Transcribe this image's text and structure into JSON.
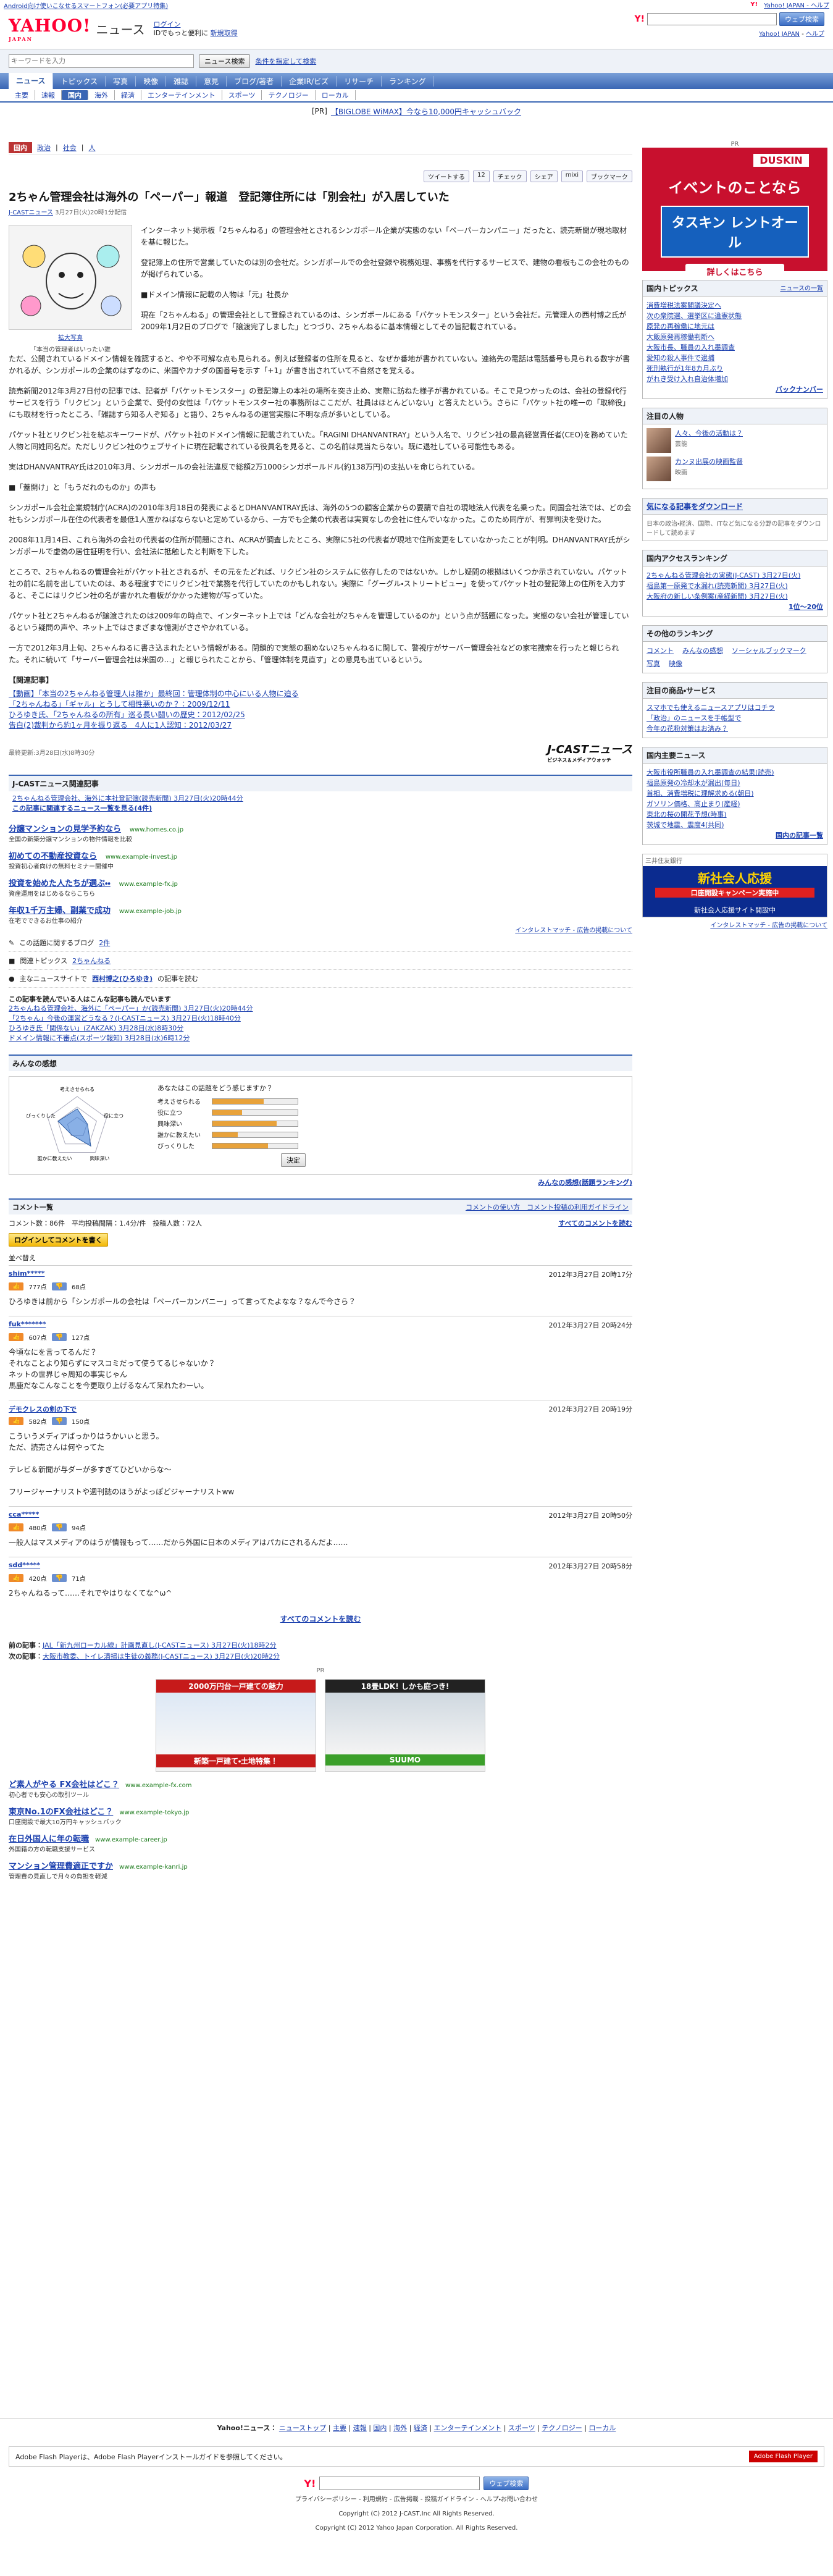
{
  "topstrip": {
    "promo": "Android向け使いこなせるスマートフォン(必要アプリ特集)",
    "home_link": "Yahoo! JAPAN - ヘルプ"
  },
  "header": {
    "logo": "YAHOO!",
    "logo_sub": "JAPAN",
    "service": "ニュース",
    "login": "ログイン",
    "signup_prompt": "IDでもっと便利に",
    "signup": "新規取得",
    "yahoo_top_link": "Yahoo! JAPAN",
    "help_link": "ヘルプ",
    "search_button": "ウェブ検索"
  },
  "news_search": {
    "placeholder": "キーワードを入力",
    "button": "ニュース検索",
    "advanced": "条件を指定して検索"
  },
  "nav_main": [
    "ニュース",
    "トピックス",
    "写真",
    "映像",
    "雑誌",
    "意見",
    "ブログ/著者",
    "企業IR/ビズ",
    "リサーチ",
    "ランキング"
  ],
  "nav_sub": [
    "主要",
    "速報",
    "国内",
    "海外",
    "経済",
    "エンターテインメント",
    "スポーツ",
    "テクノロジー",
    "ローカル"
  ],
  "pr": {
    "tag": "[PR]",
    "text": "【BIGLOBE WiMAX】今なら10,000円キャッシュバック"
  },
  "crumbs": {
    "tag": "国内",
    "items": [
      "政治",
      "社会",
      "人"
    ]
  },
  "share": {
    "tweet": "ツイートする",
    "count": "12",
    "check": "チェック",
    "fb": "シェア",
    "mixi": "mixi",
    "bookmark": "ブックマーク"
  },
  "article": {
    "title": "2ちゃん管理会社は海外の「ペーパー」報道　登記簿住所には「別会社」が入居していた",
    "source_link": "J-CASTニュース",
    "date": "3月27日(火)20時1分配信",
    "photo_caption": "「本当の管理者はいったい誰",
    "enlarge": "拡大写真",
    "paragraphs": [
      "インターネット掲示板「2ちゃんねる」の管理会社とされるシンガポール企業が実態のない「ペーパーカンパニー」だったと、読売新聞が現地取材を基に報じた。",
      "登記簿上の住所で営業していたのは別の会社だ。シンガポールでの会社登録や税務処理、事務を代行するサービスで、建物の看板もこの会社のものが掲げられている。",
      "■ドメイン情報に記載の人物は「元」社長か",
      "現在「2ちゃんねる」の管理会社として登録されているのは、シンガポールにある「パケットモンスター」という会社だ。元管理人の西村博之氏が2009年1月2日のブログで「譲渡完了しました」とつづり、2ちゃんねるに基本情報としてその旨記載されている。",
      "ただ、公開されているドメイン情報を確認すると、やや不可解な点も見られる。例えば登録者の住所を見ると、なぜか番地が書かれていない。連絡先の電話は電話番号も見られる数字が書かれるが、シンガポールの企業のはずなのに、米国やカナダの国番号を示す「+1」が書き出されていて不自然さを覚える。",
      "読売新聞2012年3月27日付の記事では、記者が「パケットモンスター」の登記簿上の本社の場所を突き止め、実際に訪ねた様子が書かれている。そこで見つかったのは、会社の登録代行サービスを行う「リクビン」という企業で、受付の女性は「パケットモンスター社の事務所はここだが、社員はほとんどいない」と答えたという。さらに「パケット社の唯一の「取締役」にも取材を行ったところ、「雑誌すら知る人ぞ知る」と語り、2ちゃんねるの運営実態に不明な点が多いとしている。",
      "パケット社とリクビン社を結ぶキーワードが、パケット社のドメイン情報に記載されていた。「RAGINI DHANVANTRAY」という人名で、リクビン社の最高経営責任者(CEO)を務めていた人物と同姓同名だ。ただしリクビン社のウェブサイトに現在記載されている役員名を見ると、この名前は見当たらない。既に退社している可能性もある。",
      "実はDHANVANTRAY氏は2010年3月、シンガポールの会社法違反で総額2万1000シンガポールドル(約138万円)の支払いを命じられている。",
      "■「蓋開け」と「もうだれのものか」の声も",
      "シンガポール会社企業規制庁(ACRA)の2010年3月18日の発表によるとDHANVANTRAY氏は、海外の5つの顧客企業からの要請で自社の現地法人代表を名乗った。同国会社法では、どの会社もシンガポール在住の代表者を最低1人置かねばならないと定めているから、一方でも企業の代表者は実質なしの会社に住んでいなかった。このため同庁が、有罪判決を受けた。",
      "2008年11月14日、これら海外の会社の代表者の住所が問題にされ、ACRAが調査したところ、実際に5社の代表者が現地で住所変更をしていなかったことが判明。DHANVANTRAY氏がシンガポールで虚偽の居住証明を行い、会社法に抵触したと判断を下した。",
      "ところで、2ちゃんねるの管理会社がパケット社とされるが、その元をたどれば、リクビン社のシステムに依存したのではないか。しかし疑問の根拠はいくつか示されていない。パケット社の前に名前を出していたのは、ある程度すでにリクビン社で業務を代行していたのかもしれない。実際に「グーグル・ストリートビュー」を使ってパケット社の登記簿上の住所を入力すると、そこにはリクビン社の名が書かれた看板がかかった建物が写っていた。",
      "パケット社と2ちゃんねるが譲渡されたのは2009年の時点で、インターネット上では「どんな会社が2ちゃんを管理しているのか」という点が話題になった。実態のない会社が管理しているという疑問の声や、ネット上ではさまざまな憶測がささやかれている。",
      "一方で2012年3月上旬、2ちゃんねるに書き込まれたという情報がある。閉鎖的で実態の掴めない2ちゃんねるに関して、警視庁がサーバー管理会社などの家宅捜索を行ったと報じられた。それに続いて「サーバー管理会社は米国の…」と報じられたことから、「管理体制を見直す」との意見も出ているという。"
    ],
    "related_heading": "【関連記事】",
    "related": [
      "【動画】「本当の2ちゃんねる管理人は誰か」最終回：管理体制の中心にいる人物に迫る",
      "「2ちゃんねる」「ギャル」とうして相性悪いのか？：2009/12/11",
      "ひろゆき氏、「2ちゃんねるの所有」巡る長い闘いの歴史：2012/02/25",
      "告白(2)裁判から約1ヶ月を振り返る　4人に1人認知：2012/03/27"
    ],
    "updated": "最終更新:3月28日(水)8時30分",
    "source_brand": "J-CASTニュース",
    "source_brand_sub": "ビジネス＆メディアウォッチ"
  },
  "related_section": {
    "heading": "J-CASTニュース関連記事",
    "items": [
      "2ちゃんねる管理会社、海外に本社登記簿(読売新聞) 3月27日(火)20時44分"
    ],
    "more": "この記事に関連するニュース一覧を見る(4件)"
  },
  "ads": [
    {
      "title": "分譲マンションの見学予約なら",
      "url": "www.homes.co.jp",
      "desc": "全国の新築分譲マンションの物件情報を比較"
    },
    {
      "title": "初めての不動産投資なら",
      "url": "www.example-invest.jp",
      "desc": "投資初心者向けの無料セミナー開催中"
    },
    {
      "title": "投資を始めた人たちが選ぶ・・",
      "url": "www.example-fx.jp",
      "desc": "資産運用をはじめるならこちら"
    },
    {
      "title": "年収1千万主婦、副業で成功",
      "url": "www.example-job.jp",
      "desc": "在宅でできるお仕事の紹介"
    }
  ],
  "ad_note": "インタレストマッチ - 広告の掲載について",
  "blog_section": {
    "label": "この話題に関するブログ",
    "count": "2件"
  },
  "topics_section": {
    "label": "関連トピックス",
    "link": "2ちゃんねる"
  },
  "writer_section": {
    "prefix": "主なニュースサイトで",
    "name": "西村博之(ひろゆき)",
    "suffix": "の記事を読む"
  },
  "readers_section": {
    "heading": "この記事を読んでいる人はこんな記事も読んでいます",
    "items": [
      "2ちゃんねる管理会社、海外に「ペーパー」か(読売新聞) 3月27日(火)20時44分",
      "「2ちゃん」今後の運営どうなる？(J-CASTニュース) 3月27日(火)18時40分",
      "ひろゆき氏「関係ない」(ZAKZAK) 3月28日(水)8時30分",
      "ドメイン情報に不審点(スポーツ報知) 3月28日(水)6時12分"
    ]
  },
  "impressions": {
    "heading": "みんなの感想",
    "question": "あなたはこの話題をどう感じますか？",
    "axes": [
      "考えさせられる",
      "役に立つ",
      "興味深い",
      "誰かに教えたい",
      "びっくりした"
    ],
    "values": [
      0.6,
      0.35,
      0.75,
      0.3,
      0.65
    ],
    "decide": "決定",
    "ranking": "みんなの感想(話題ランキング)"
  },
  "comments": {
    "header_left": "コメント一覧",
    "header_right": "コメントの使い方　コメント投稿の利用ガイドライン",
    "stats": "コメント数：86件　平均投稿間隔：1.4分/件　投稿人数：72人",
    "all_link": "すべてのコメントを読む",
    "login_btn": "ログインしてコメントを書く",
    "sort": "並べ替え",
    "list": [
      {
        "user": "shim*****",
        "time": "2012年3月27日 20時17分",
        "good": "777点",
        "bad": "68点",
        "text": "ひろゆきは前から「シンガポールの会社は「ペーパーカンパニー」って言ってたよなな？なんで今さら？"
      },
      {
        "user": "fuk*******",
        "time": "2012年3月27日 20時24分",
        "good": "607点",
        "bad": "127点",
        "text": "今頃なにを言ってるんだ？\nそれなことより知らずにマスコミだって使うてるじゃないか？\nネットの世界じゃ周知の事実じゃん\n馬鹿だなこんなことを今更取り上げるなんて呆れたわーい。"
      },
      {
        "user": "デモクレスの剣の下で",
        "time": "2012年3月27日 20時19分",
        "good": "582点",
        "bad": "150点",
        "text": "こういうメディアばっかりはうかいぃと思う。\nただ、読売さんは何やってた\n\nテレビ＆新聞が与ダーが多すぎてひどいからな～\n\nフリージャーナリストや週刊誌のほうがよっぽどジャーナリストww"
      },
      {
        "user": "cca*****",
        "time": "2012年3月27日 20時50分",
        "good": "480点",
        "bad": "94点",
        "text": "一般人はマスメディアのはうが情報もって……だから外国に日本のメディアはパカにされるんだよ……"
      },
      {
        "user": "sdd*****",
        "time": "2012年3月27日 20時58分",
        "good": "420点",
        "bad": "71点",
        "text": "2ちゃんねるって……それでやはりなくてな^ω^"
      }
    ],
    "read_all": "すべてのコメントを読む"
  },
  "prev_next": {
    "prev_label": "前の記事",
    "prev": "JAL「新九州ローカル線」計画見直し(J-CASTニュース) 3月27日(火)18時2分",
    "next_label": "次の記事",
    "next": "大阪市教委、トイレ清掃は生徒の義務(J-CASTニュース) 3月27日(火)20時2分"
  },
  "bottom_ads": {
    "pr": "PR",
    "b1_head": "2000万円台一戸建ての魅力",
    "b1_sub": "新築一戸建て・土地特集！",
    "b2_head": "18畳LDK! しかも庭つき!",
    "b2_brand": "SUUMO"
  },
  "bottom_text_ads": [
    {
      "title": "ど素人がやる FX会社はどこ？",
      "url": "www.example-fx.com",
      "desc": "初心者でも安心の取引ツール"
    },
    {
      "title": "東京No.1のFX会社はどこ？",
      "url": "www.example-tokyo.jp",
      "desc": "口座開設で最大10万円キャッシュバック"
    },
    {
      "title": "在日外国人に年の転職",
      "url": "www.example-career.jp",
      "desc": "外国籍の方の転職支援サービス"
    },
    {
      "title": "マンション管理費適正ですか",
      "url": "www.example-kanri.jp",
      "desc": "管理費の見直しで月々の負担を軽減"
    }
  ],
  "sidebar": {
    "pr_label": "PR",
    "duskin": {
      "brand": "DUSKIN",
      "catch": "イベントのことなら",
      "product": "タスキン レントオール",
      "go": "詳しくはこちら"
    },
    "topics_heading": "国内トピックス",
    "topics_link": "ニュースの一覧",
    "topics": [
      "消費増税法案閣議決定へ",
      "次の衆院選、選挙区に違憲状態",
      "原発の再稼働に地元は",
      "大飯原発再稼働判断へ",
      "大阪市長、職員の入れ墨調査",
      "愛知の殺人事件で逮捕",
      "死刑執行が1年8カ月ぶり",
      "がれき受け入れ自治体増加"
    ],
    "topics_more": "バックナンバー",
    "person_heading": "注目の人物",
    "persons": [
      {
        "name": "人々、今後の活動は？",
        "desc": "芸能"
      },
      {
        "name": "カンヌ出展の映画監督",
        "desc": "映画"
      }
    ],
    "download_heading": "気になる記事をダウンロード",
    "download_text": "日本の政治・経済、国際、ITなど気になる分野の記事をダウンロードして読めます",
    "access_heading": "国内アクセスランキング",
    "access_items": [
      "2ちゃんねる管理会社の実態(J-CAST) 3月27日(火)",
      "福島第一原発で水漏れ(読売新聞) 3月27日(火)",
      "大阪府の新しい条例案(産経新聞) 3月27日(火)"
    ],
    "access_more": "1位〜20位",
    "ranking_heading": "その他のランキング",
    "ranking_links": [
      "コメント",
      "みんなの感想",
      "ソーシャルブックマーク",
      "写真",
      "映像"
    ],
    "product_heading": "注目の商品・サービス",
    "products": [
      "スマホでも使えるニュースアプリはコチラ",
      "「政治」のニュースを手帳型で",
      "今年の花粉対策はお済み？"
    ],
    "local_heading": "国内主要ニュース",
    "local": [
      "大阪市役所職員の入れ墨調査の結果(読売)",
      "福島原発の冷却水が漏出(毎日)",
      "首相、消費増税に理解求める(朝日)",
      "ガソリン価格、高止まり(産経)",
      "東北の桜の開花予想(時事)",
      "茨城で地震、震度4(共同)"
    ],
    "local_more": "国内の記事一覧",
    "bank_label": "三井住友銀行",
    "bank_head": "新社会人応援",
    "bank_sub": "口座開設キャンペーン実施中",
    "bank_foot": "新社会人応援サイト開設中",
    "ad_note": "インタレストマッチ - 広告の掲載について"
  },
  "footer": {
    "nav_label": "Yahoo!ニュース：",
    "nav": [
      "ニューストップ",
      "主要",
      "速報",
      "国内",
      "海外",
      "経済",
      "エンターテインメント",
      "スポーツ",
      "テクノロジー",
      "ローカル"
    ],
    "flash_text": "Adobe Flash Playerは、Adobe Flash Playerインストールガイドを参照してください。",
    "flash_button": "Adobe Flash Player",
    "search_button": "ウェブ検索",
    "links": "プライバシーポリシー - 利用規約 - 広告掲載 - 投稿ガイドライン - ヘルプ・お問い合わせ",
    "copyright": "Copyright (C) 2012 J-CAST,Inc All Rights Reserved.",
    "copyright2": "Copyright (C) 2012 Yahoo Japan Corporation. All Rights Reserved."
  }
}
